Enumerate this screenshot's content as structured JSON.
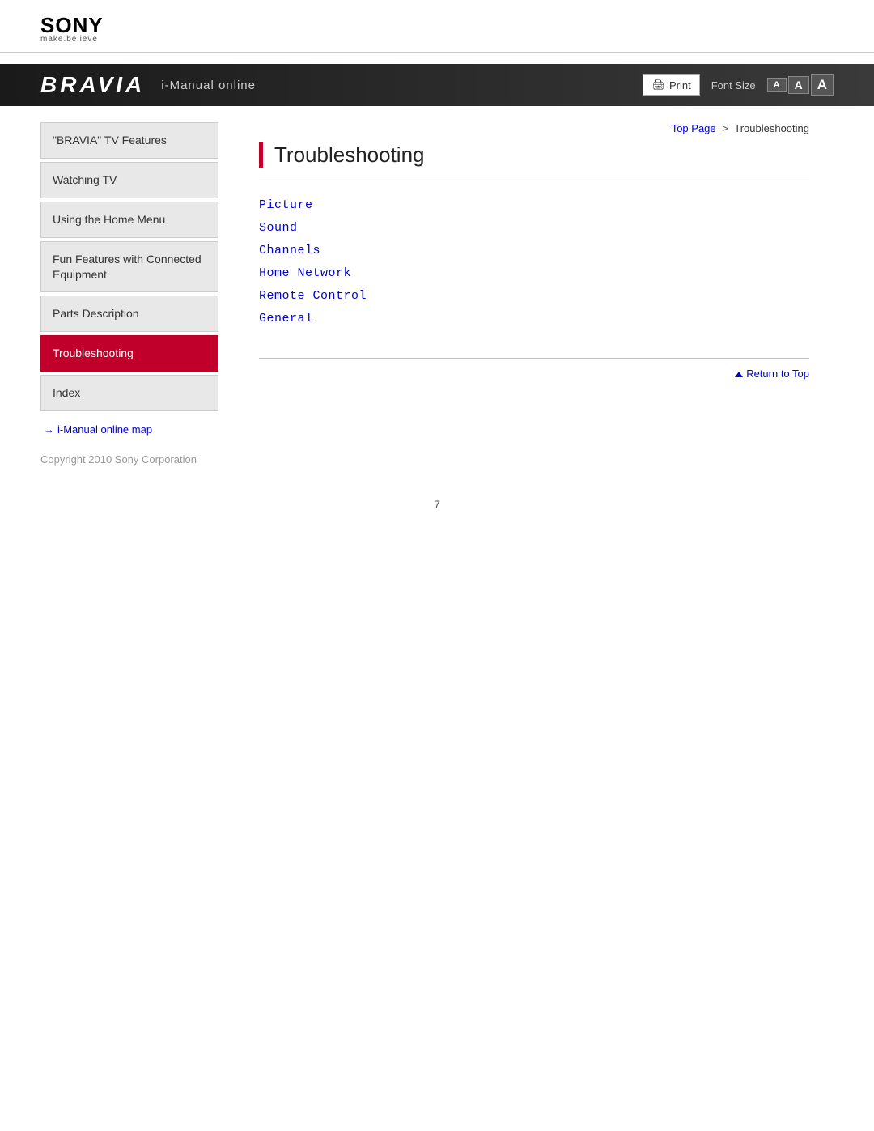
{
  "logo": {
    "sony": "SONY",
    "tagline": "make.believe"
  },
  "banner": {
    "bravia": "BRAVIA",
    "imanual": "i-Manual online",
    "print_label": "Print",
    "font_size_label": "Font Size",
    "font_btn_small": "A",
    "font_btn_medium": "A",
    "font_btn_large": "A"
  },
  "breadcrumb": {
    "top_page": "Top Page",
    "separator": ">",
    "current": "Troubleshooting"
  },
  "sidebar": {
    "items": [
      {
        "label": "\"BRAVIA\" TV Features",
        "active": false
      },
      {
        "label": "Watching TV",
        "active": false
      },
      {
        "label": "Using the Home Menu",
        "active": false
      },
      {
        "label": "Fun Features with Connected Equipment",
        "active": false
      },
      {
        "label": "Parts Description",
        "active": false
      },
      {
        "label": "Troubleshooting",
        "active": true
      },
      {
        "label": "Index",
        "active": false
      }
    ],
    "map_link": "i-Manual online map",
    "map_arrow": "→"
  },
  "content": {
    "page_title": "Troubleshooting",
    "links": [
      {
        "label": "Picture"
      },
      {
        "label": "Sound"
      },
      {
        "label": "Channels"
      },
      {
        "label": "Home Network"
      },
      {
        "label": "Remote Control"
      },
      {
        "label": "General"
      }
    ],
    "return_to_top": "Return to Top"
  },
  "footer": {
    "copyright": "Copyright 2010 Sony Corporation"
  },
  "page_number": "7"
}
